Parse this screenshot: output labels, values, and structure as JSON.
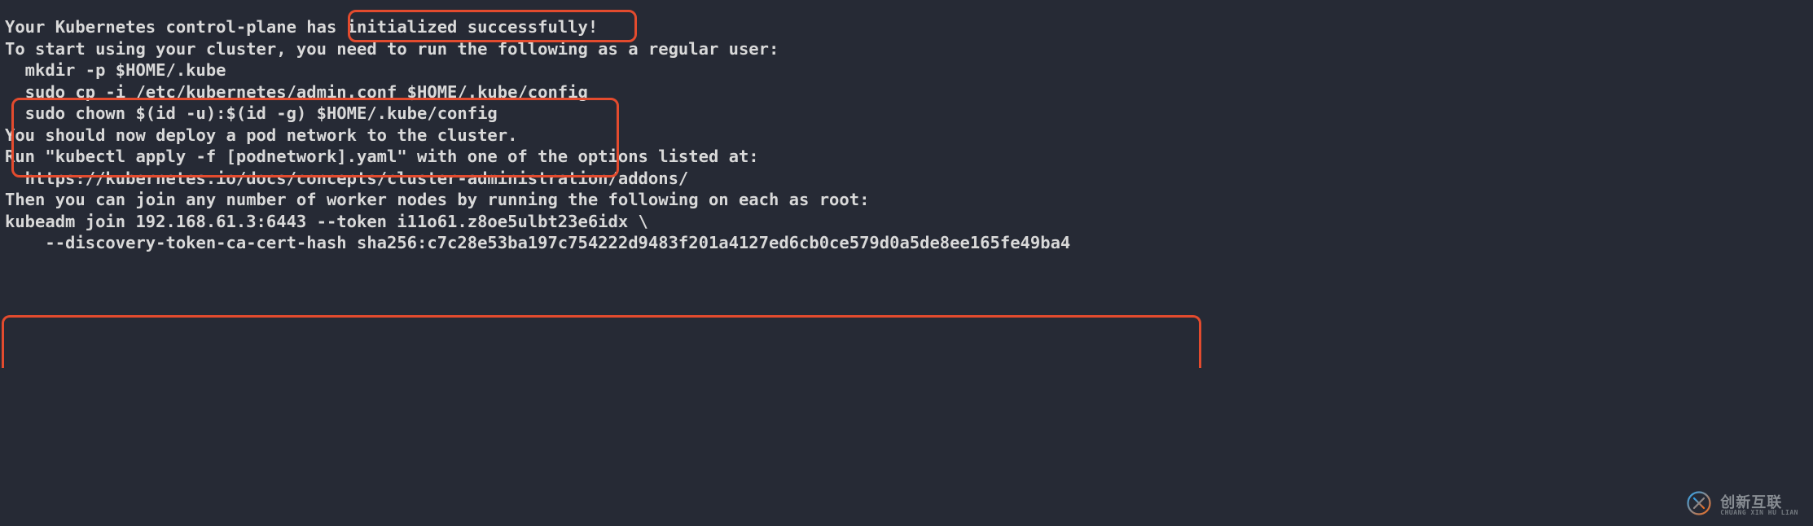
{
  "lines": [
    "Your Kubernetes control-plane has initialized successfully!",
    "",
    "To start using your cluster, you need to run the following as a regular user:",
    "",
    "  mkdir -p $HOME/.kube",
    "  sudo cp -i /etc/kubernetes/admin.conf $HOME/.kube/config",
    "  sudo chown $(id -u):$(id -g) $HOME/.kube/config",
    "",
    "You should now deploy a pod network to the cluster.",
    "Run \"kubectl apply -f [podnetwork].yaml\" with one of the options listed at:",
    "  https://kubernetes.io/docs/concepts/cluster-administration/addons/",
    "",
    "Then you can join any number of worker nodes by running the following on each as root:",
    "",
    "kubeadm join 192.168.61.3:6443 --token i11o61.z8oe5ulbt23e6idx \\",
    "    --discovery-token-ca-cert-hash sha256:c7c28e53ba197c754222d9483f201a4127ed6cb0ce579d0a5de8ee165fe49ba4"
  ],
  "watermark": {
    "cn": "创新互联",
    "en": "CHUANG XIN HU LIAN"
  }
}
